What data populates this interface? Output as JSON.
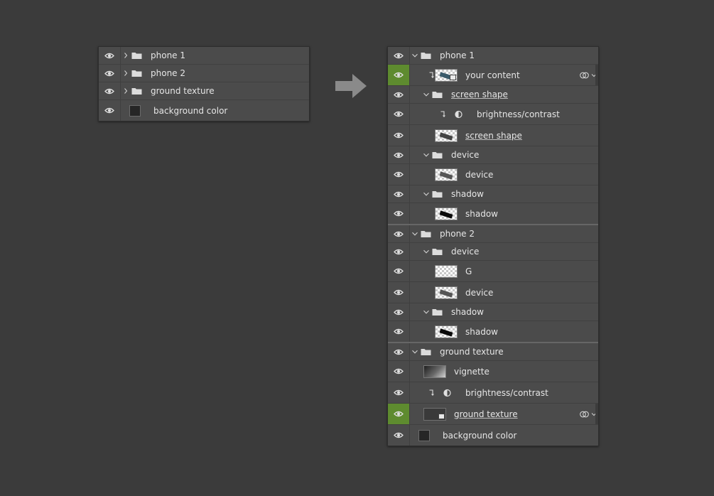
{
  "collapsed_panel": {
    "layers": [
      {
        "name": "phone 1",
        "type": "group"
      },
      {
        "name": "phone 2",
        "type": "group"
      },
      {
        "name": "ground texture",
        "type": "group"
      },
      {
        "name": "background color",
        "type": "fill"
      }
    ]
  },
  "expanded_panel": {
    "layers": [
      {
        "name": "phone 1",
        "type": "group"
      },
      {
        "name": "your content",
        "type": "smart-object",
        "selected": true
      },
      {
        "name": "screen shape",
        "type": "group"
      },
      {
        "name": "brightness/contrast",
        "type": "adjustment"
      },
      {
        "name": "screen shape",
        "type": "layer"
      },
      {
        "name": "device",
        "type": "group"
      },
      {
        "name": "device",
        "type": "layer"
      },
      {
        "name": "shadow",
        "type": "group"
      },
      {
        "name": "shadow",
        "type": "layer"
      },
      {
        "name": "phone 2",
        "type": "group"
      },
      {
        "name": "device",
        "type": "group"
      },
      {
        "name": "G",
        "type": "layer"
      },
      {
        "name": "device",
        "type": "layer"
      },
      {
        "name": "shadow",
        "type": "group"
      },
      {
        "name": "shadow",
        "type": "layer"
      },
      {
        "name": "ground texture",
        "type": "group"
      },
      {
        "name": "vignette",
        "type": "layer"
      },
      {
        "name": "brightness/contrast",
        "type": "adjustment"
      },
      {
        "name": "ground texture",
        "type": "smart-object",
        "selected": true
      },
      {
        "name": "background color",
        "type": "fill"
      }
    ]
  },
  "icons": {
    "visibility": "eye-icon",
    "group": "folder-icon",
    "collapsed": "chevron-right-icon",
    "expanded": "chevron-down-icon",
    "clip": "clip-arrow-icon",
    "adjustment": "half-circle-icon",
    "link": "link-icon",
    "arrow": "arrow-right-icon"
  },
  "colors": {
    "background": "#3b3b3b",
    "panel": "#4b4b4b",
    "active_eye": "#5e8b2f",
    "text": "#e6e6e6"
  }
}
